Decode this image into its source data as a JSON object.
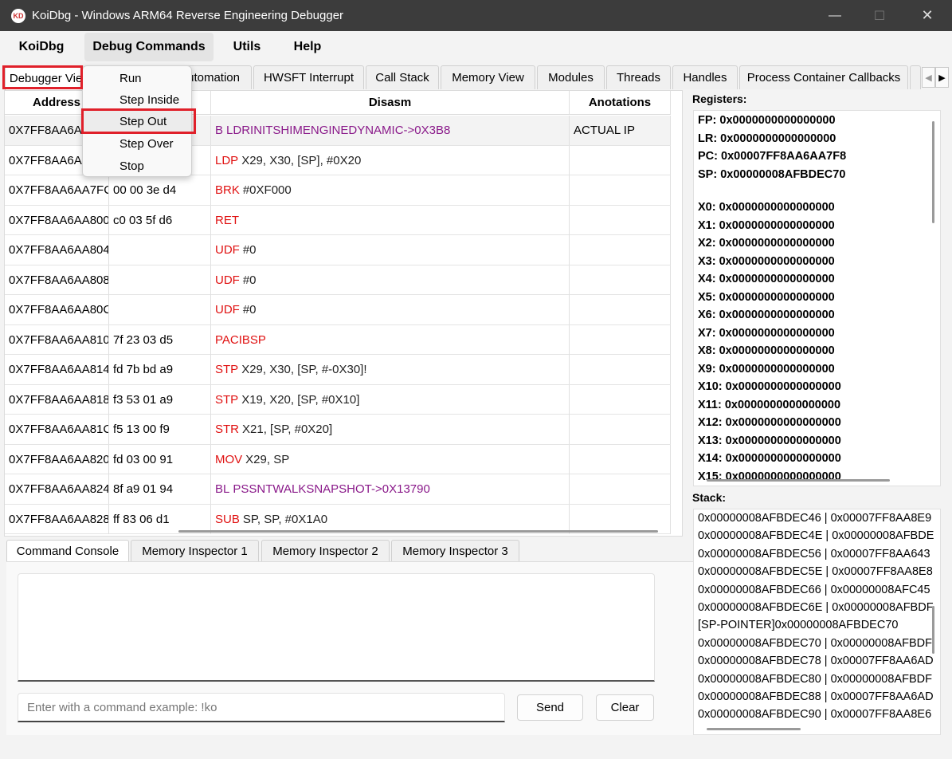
{
  "window": {
    "title": "KoiDbg - Windows ARM64 Reverse Engineering Debugger",
    "app_icon_text": "KD",
    "minimize_glyph": "—",
    "maximize_glyph": "☐",
    "close_glyph": "✕"
  },
  "menubar": {
    "items": [
      "KoiDbg",
      "Debug Commands",
      "Utils",
      "Help"
    ]
  },
  "debug_menu": {
    "items": [
      "Run",
      "Step Inside",
      "Step Out",
      "Step Over",
      "Stop"
    ],
    "highlighted": "Step Out"
  },
  "main_tabs": {
    "items": [
      "Debugger View",
      "Automation",
      "HWSFT Interrupt",
      "Call Stack",
      "Memory View",
      "Modules",
      "Threads",
      "Handles",
      "Process Container Callbacks"
    ],
    "active": "Debugger View",
    "left_arrow": "◀",
    "right_arrow": "▶"
  },
  "disasm": {
    "columns": [
      "Address",
      "",
      "Disasm",
      "Anotations"
    ],
    "rows": [
      {
        "address": "0X7FF8AA6AA7F8",
        "bytes": "",
        "mnemonic": "B",
        "operands": "LDRINITSHIMENGINEDYNAMIC->0X3B8",
        "purple": true,
        "annotation": "ACTUAL IP"
      },
      {
        "address": "0X7FF8AA6AA7FC",
        "bytes": "",
        "mnemonic": "LDP",
        "operands": "X29, X30, [SP], #0X20",
        "purple": false,
        "annotation": ""
      },
      {
        "address": "0X7FF8AA6AA7FC",
        "bytes": "00 00 3e d4",
        "mnemonic": "BRK",
        "operands": "#0XF000",
        "purple": false,
        "annotation": ""
      },
      {
        "address": "0X7FF8AA6AA800",
        "bytes": "c0 03 5f d6",
        "mnemonic": "RET",
        "operands": "",
        "purple": false,
        "annotation": ""
      },
      {
        "address": "0X7FF8AA6AA804",
        "bytes": "",
        "mnemonic": "UDF",
        "operands": "#0",
        "purple": false,
        "annotation": ""
      },
      {
        "address": "0X7FF8AA6AA808",
        "bytes": "",
        "mnemonic": "UDF",
        "operands": "#0",
        "purple": false,
        "annotation": ""
      },
      {
        "address": "0X7FF8AA6AA80C",
        "bytes": "",
        "mnemonic": "UDF",
        "operands": "#0",
        "purple": false,
        "annotation": ""
      },
      {
        "address": "0X7FF8AA6AA810",
        "bytes": "7f 23 03 d5",
        "mnemonic": "PACIBSP",
        "operands": "",
        "purple": false,
        "annotation": ""
      },
      {
        "address": "0X7FF8AA6AA814",
        "bytes": "fd 7b bd a9",
        "mnemonic": "STP",
        "operands": "X29, X30, [SP, #-0X30]!",
        "purple": false,
        "annotation": ""
      },
      {
        "address": "0X7FF8AA6AA818",
        "bytes": "f3 53 01 a9",
        "mnemonic": "STP",
        "operands": "X19, X20, [SP, #0X10]",
        "purple": false,
        "annotation": ""
      },
      {
        "address": "0X7FF8AA6AA81C",
        "bytes": "f5 13 00 f9",
        "mnemonic": "STR",
        "operands": "X21, [SP, #0X20]",
        "purple": false,
        "annotation": ""
      },
      {
        "address": "0X7FF8AA6AA820",
        "bytes": "fd 03 00 91",
        "mnemonic": "MOV",
        "operands": "X29, SP",
        "purple": false,
        "annotation": ""
      },
      {
        "address": "0X7FF8AA6AA824",
        "bytes": "8f a9 01 94",
        "mnemonic": "BL",
        "operands": "PSSNTWALKSNAPSHOT->0X13790",
        "purple": true,
        "annotation": ""
      },
      {
        "address": "0X7FF8AA6AA828",
        "bytes": "ff 83 06 d1",
        "mnemonic": "SUB",
        "operands": "SP, SP, #0X1A0",
        "purple": false,
        "annotation": ""
      }
    ]
  },
  "registers": {
    "label": "Registers:",
    "special": [
      "FP: 0x0000000000000000",
      "LR: 0x0000000000000000",
      "PC: 0x00007FF8AA6AA7F8",
      "SP: 0x00000008AFBDEC70"
    ],
    "general": [
      "X0: 0x0000000000000000",
      "X1: 0x0000000000000000",
      "X2: 0x0000000000000000",
      "X3: 0x0000000000000000",
      "X4: 0x0000000000000000",
      "X5: 0x0000000000000000",
      "X6: 0x0000000000000000",
      "X7: 0x0000000000000000",
      "X8: 0x0000000000000000",
      "X9: 0x0000000000000000",
      "X10: 0x0000000000000000",
      "X11: 0x0000000000000000",
      "X12: 0x0000000000000000",
      "X13: 0x0000000000000000",
      "X14: 0x0000000000000000",
      "X15: 0x0000000000000000"
    ]
  },
  "stack": {
    "label": "Stack:",
    "lines": [
      "0x00000008AFBDEC46 | 0x00007FF8AA8E9",
      "0x00000008AFBDEC4E | 0x00000008AFBDE",
      "0x00000008AFBDEC56 | 0x00007FF8AA643",
      "0x00000008AFBDEC5E | 0x00007FF8AA8E8",
      "0x00000008AFBDEC66 | 0x00000008AFC45",
      "0x00000008AFBDEC6E | 0x00000008AFBDF",
      "[SP-POINTER]0x00000008AFBDEC70",
      "0x00000008AFBDEC70 | 0x00000008AFBDF",
      "0x00000008AFBDEC78 | 0x00007FF8AA6AD",
      "0x00000008AFBDEC80 | 0x00000008AFBDF",
      "0x00000008AFBDEC88 | 0x00007FF8AA6AD",
      "0x00000008AFBDEC90 | 0x00007FF8AA8E6"
    ]
  },
  "bottom_tabs": {
    "items": [
      "Command Console",
      "Memory Inspector 1",
      "Memory Inspector 2",
      "Memory Inspector 3"
    ],
    "active": "Command Console"
  },
  "console": {
    "output": "",
    "input_value": "",
    "placeholder": "Enter with a command example: !ko",
    "send_label": "Send",
    "clear_label": "Clear"
  },
  "colors": {
    "highlight": "#e0202a",
    "mnemonic": "#e01010",
    "call_target": "#8a1a8a",
    "titlebar": "#3c3c3c"
  }
}
